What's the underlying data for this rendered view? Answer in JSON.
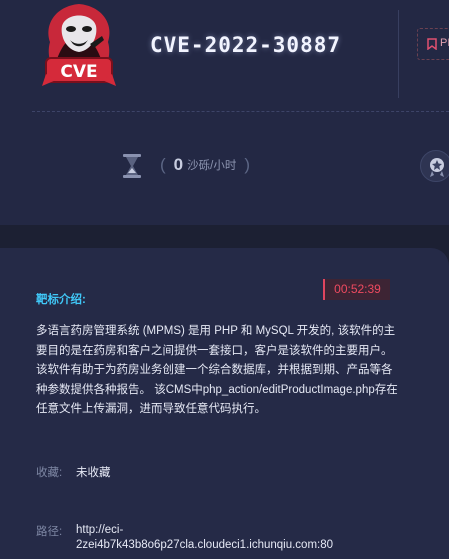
{
  "header": {
    "cve_id": "CVE-2022-30887",
    "logo_text": "CVE",
    "tag_label": "PI"
  },
  "stats": {
    "open_paren": "(",
    "reward_value": "0",
    "reward_unit": "沙砾/小时",
    "close_paren": ")",
    "hourglass_icon": "hourglass-icon",
    "medal_icon": "medal-icon"
  },
  "target": {
    "timer": "00:52:39",
    "intro_label": "靶标介绍:",
    "description": "多语言药房管理系统 (MPMS) 是用 PHP 和 MySQL 开发的, 该软件的主要目的是在药房和客户之间提供一套接口，客户是该软件的主要用户。该软件有助于为药房业务创建一个综合数据库，并根据到期、产品等各种参数提供各种报告。 该CMS中php_action/editProductImage.php存在任意文件上传漏洞，进而导致任意代码执行。",
    "favorite_label": "收藏:",
    "favorite_value": "未收藏",
    "path_label": "路径:",
    "path_url": "http://eci-2zei4b7k43b8o6p27cla.cloudeci1.ichunqiu.com:80"
  },
  "colors": {
    "page_bg": "#1c2033",
    "panel_bg": "#232844",
    "accent_cyan": "#40c8f8",
    "timer_red": "#ee4a60",
    "logo_red": "#d52a3a"
  }
}
